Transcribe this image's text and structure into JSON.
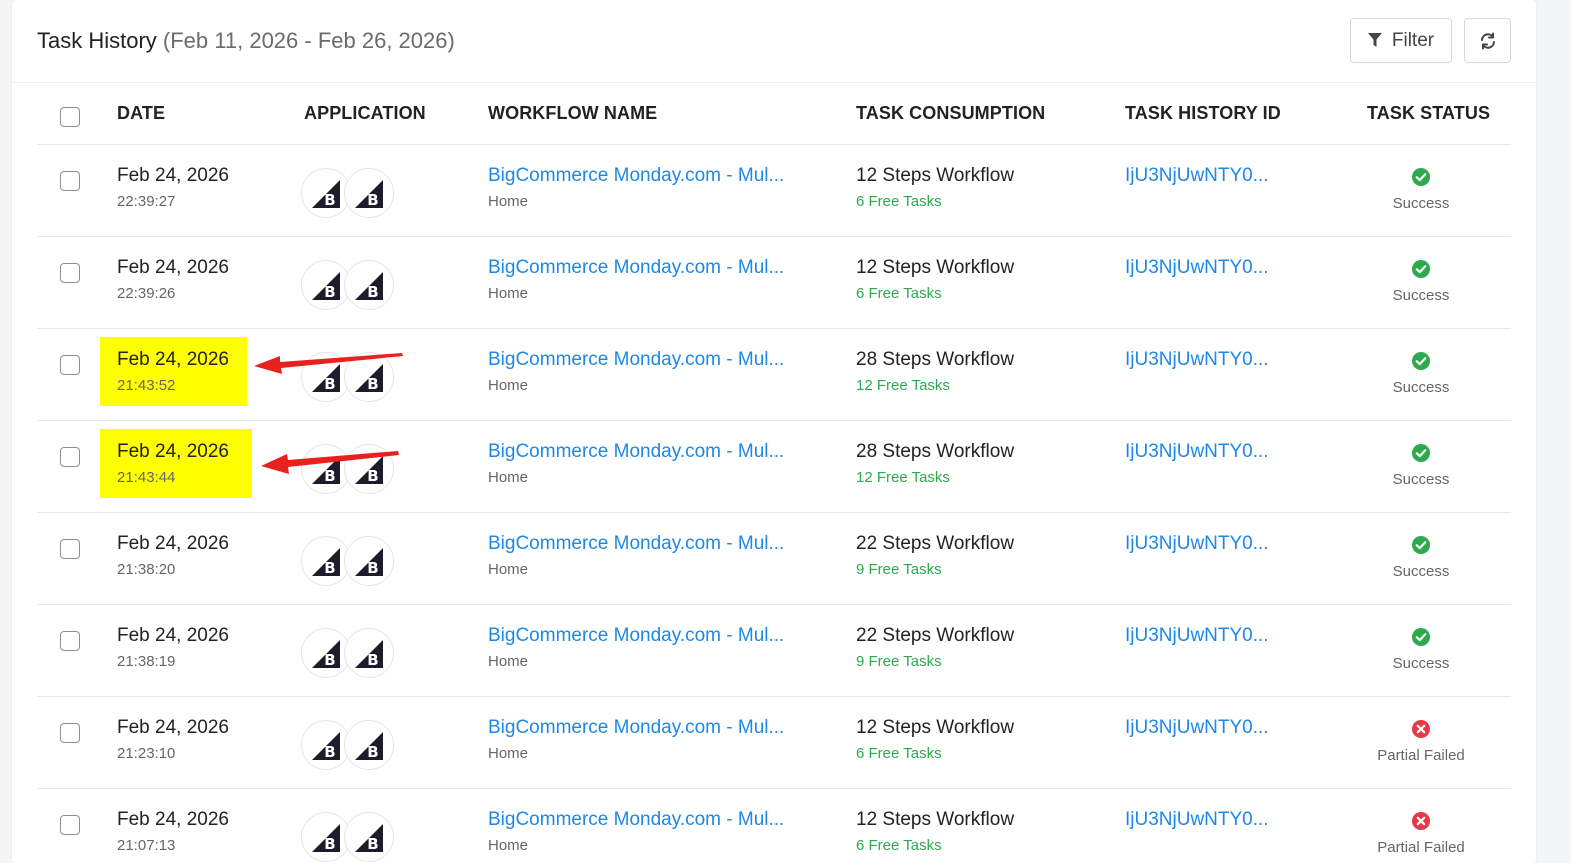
{
  "header": {
    "title": "Task History",
    "date_range": "(Feb 11, 2026 - Feb 26, 2026)",
    "filter_label": "Filter",
    "filter_icon": "filter-icon",
    "refresh_icon": "refresh-icon"
  },
  "columns": {
    "date": "DATE",
    "application": "APPLICATION",
    "workflow": "WORKFLOW NAME",
    "consumption": "TASK CONSUMPTION",
    "history_id": "TASK HISTORY ID",
    "status": "TASK STATUS"
  },
  "app_icon": "bigcommerce-icon",
  "colors": {
    "link": "#1e88e5",
    "free_tasks": "#2eaa4d",
    "success": "#2eaa4d",
    "failed": "#e53945",
    "highlight": "#ffff00",
    "annotation_arrow": "#e8211d"
  },
  "rows": [
    {
      "date": "Feb 24, 2026",
      "time": "22:39:27",
      "workflow": "BigCommerce Monday.com - Mul...",
      "folder": "Home",
      "steps": "12 Steps Workflow",
      "free": "6 Free Tasks",
      "id": "IjU3NjUwNTY0...",
      "status": "Success",
      "highlighted": false
    },
    {
      "date": "Feb 24, 2026",
      "time": "22:39:26",
      "workflow": "BigCommerce Monday.com - Mul...",
      "folder": "Home",
      "steps": "12 Steps Workflow",
      "free": "6 Free Tasks",
      "id": "IjU3NjUwNTY0...",
      "status": "Success",
      "highlighted": false
    },
    {
      "date": "Feb 24, 2026",
      "time": "21:43:52",
      "workflow": "BigCommerce Monday.com - Mul...",
      "folder": "Home",
      "steps": "28 Steps Workflow",
      "free": "12 Free Tasks",
      "id": "IjU3NjUwNTY0...",
      "status": "Success",
      "highlighted": true
    },
    {
      "date": "Feb 24, 2026",
      "time": "21:43:44",
      "workflow": "BigCommerce Monday.com - Mul...",
      "folder": "Home",
      "steps": "28 Steps Workflow",
      "free": "12 Free Tasks",
      "id": "IjU3NjUwNTY0...",
      "status": "Success",
      "highlighted": true
    },
    {
      "date": "Feb 24, 2026",
      "time": "21:38:20",
      "workflow": "BigCommerce Monday.com - Mul...",
      "folder": "Home",
      "steps": "22 Steps Workflow",
      "free": "9 Free Tasks",
      "id": "IjU3NjUwNTY0...",
      "status": "Success",
      "highlighted": false
    },
    {
      "date": "Feb 24, 2026",
      "time": "21:38:19",
      "workflow": "BigCommerce Monday.com - Mul...",
      "folder": "Home",
      "steps": "22 Steps Workflow",
      "free": "9 Free Tasks",
      "id": "IjU3NjUwNTY0...",
      "status": "Success",
      "highlighted": false
    },
    {
      "date": "Feb 24, 2026",
      "time": "21:23:10",
      "workflow": "BigCommerce Monday.com - Mul...",
      "folder": "Home",
      "steps": "12 Steps Workflow",
      "free": "6 Free Tasks",
      "id": "IjU3NjUwNTY0...",
      "status": "Partial Failed",
      "highlighted": false
    },
    {
      "date": "Feb 24, 2026",
      "time": "21:07:13",
      "workflow": "BigCommerce Monday.com - Mul...",
      "folder": "Home",
      "steps": "12 Steps Workflow",
      "free": "6 Free Tasks",
      "id": "IjU3NjUwNTY0...",
      "status": "Partial Failed",
      "highlighted": false
    }
  ]
}
